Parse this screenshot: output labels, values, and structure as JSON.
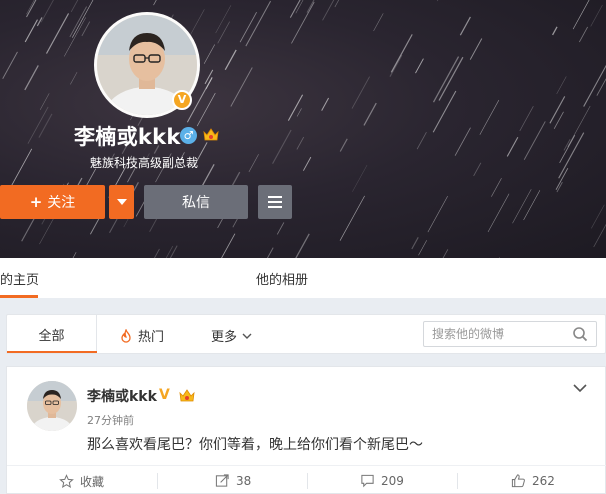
{
  "profile": {
    "name": "李楠或kkk",
    "description": "魅族科技高级副总裁",
    "verified_badge": "V",
    "gender_symbol": "♂"
  },
  "actions": {
    "follow_label": "关注",
    "follow_plus": "+",
    "message_label": "私信"
  },
  "tabs": [
    {
      "label": "的主页"
    },
    {
      "label": "他的相册"
    }
  ],
  "filters": {
    "all_label": "全部",
    "hot_label": "热门",
    "more_label": "更多"
  },
  "search": {
    "placeholder": "搜索他的微博"
  },
  "post": {
    "author": "李楠或kkk",
    "verified_mark": "V",
    "time": "27分钟前",
    "text": "那么喜欢看尾巴？你们等着，晚上给你们看个新尾巴～",
    "favorite_label": "收藏",
    "share_count": "38",
    "comment_count": "209",
    "like_count": "262"
  },
  "colors": {
    "accent": "#f26b22",
    "verified": "#f5a623",
    "button_gray": "#6b6e78"
  }
}
